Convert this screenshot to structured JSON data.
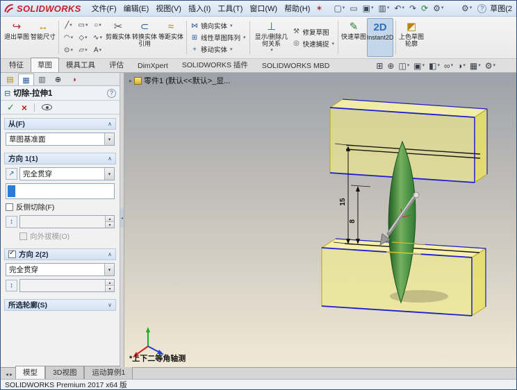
{
  "glyphs": {
    "dropdown": "▾",
    "chevron_up": "∧",
    "chevron_down": "∨",
    "breadcrumb_arrow": "▸",
    "splitter": "◂",
    "nav_left": "◂",
    "nav_right": "▸"
  },
  "colors": {
    "brand_red": "#c8202a",
    "selection_blue": "#2e7bd6",
    "slab_yellow": "#f4ee86",
    "edge_blue": "#1c1cd0",
    "lens_green": "#2f7a33"
  },
  "titlebar": {
    "brand": "SOLIDWORKS",
    "menus": [
      "文件(F)",
      "编辑(E)",
      "视图(V)",
      "插入(I)",
      "工具(T)",
      "窗口(W)",
      "帮助(H)"
    ],
    "pin": "✶",
    "quick": {
      "new": "▢",
      "open": "▭",
      "save": "▣",
      "print": "▥",
      "undo": "↶",
      "redo": "↷",
      "rebuild": "⟳",
      "options": "⚙",
      "help": "?"
    },
    "right_label": "草图(2"
  },
  "ribbon": {
    "exit_sketch": {
      "label": "退出草图",
      "glyph": "↪"
    },
    "smart_dimension": {
      "label": "智能尺寸",
      "glyph": "↔"
    },
    "entity_glyphs": [
      "╱",
      "▭",
      "○",
      "◠",
      "◇",
      "∿",
      "⊙",
      "▱",
      "A"
    ],
    "trim": {
      "label": "剪裁实体",
      "glyph": "✂"
    },
    "convert": {
      "label": "转换实体引用",
      "glyph": "⊂"
    },
    "offset": {
      "label": "等距实体",
      "glyph": "≈"
    },
    "mirror": {
      "label": "镜向实体",
      "glyph": "⋈"
    },
    "linear_pattern": {
      "label": "线性草图阵列",
      "glyph": "⊞"
    },
    "move": {
      "label": "移动实体",
      "glyph": "+"
    },
    "relations": {
      "label": "显示/删除几何关系",
      "glyph": "⊥"
    },
    "repair": {
      "label": "修复草图",
      "glyph": "⚒"
    },
    "quick_snaps": {
      "label": "快速捕捉",
      "glyph": "◎"
    },
    "rapid_sketch": {
      "label": "快速草图",
      "glyph": "✎"
    },
    "instant2d": {
      "label": "Instant2D",
      "glyph": "2D"
    },
    "shaded_contours": {
      "label": "上色草图轮廓",
      "glyph": "◩"
    }
  },
  "tabs": [
    "特征",
    "草图",
    "模具工具",
    "评估",
    "DimXpert",
    "SOLIDWORKS 插件",
    "SOLIDWORKS MBD"
  ],
  "viewbar": {
    "zoom_area": "⊞",
    "zoom_fit": "⊕",
    "section": "◫",
    "orientation": "▣",
    "display_style": "◧",
    "hide_show": "∞",
    "appearance": "◑",
    "scene": "▦",
    "settings": "⚙"
  },
  "pm": {
    "tab_glyphs": [
      "▤",
      "▦",
      "▥",
      "⊕",
      "◑"
    ],
    "title": "切除-拉伸1",
    "title_glyph": "⊟",
    "help": "?",
    "ok": "✓",
    "cancel": "×",
    "from": {
      "label": "从(F)",
      "combo": "草图基准面"
    },
    "dir1": {
      "label": "方向 1(1)",
      "combo": "完全贯穿",
      "dir_glyph": "↗",
      "flip": "反侧切除(F)",
      "depth_glyph": "↕",
      "depth": "",
      "draft": "向外拔模(O)"
    },
    "dir2": {
      "label": "方向 2(2)",
      "combo": "完全贯穿",
      "depth_glyph": "↕",
      "depth": ""
    },
    "contours": {
      "label": "所选轮廓(S)"
    }
  },
  "viewport": {
    "breadcrumb": "零件1 (默认<<默认>_显...",
    "dim_15": "15",
    "dim_8": "8",
    "view_label": "*上下二等角轴测"
  },
  "doctabs": [
    "模型",
    "3D视图",
    "运动算例1"
  ],
  "statusbar": {
    "text": "SOLIDWORKS Premium 2017 x64 版"
  }
}
